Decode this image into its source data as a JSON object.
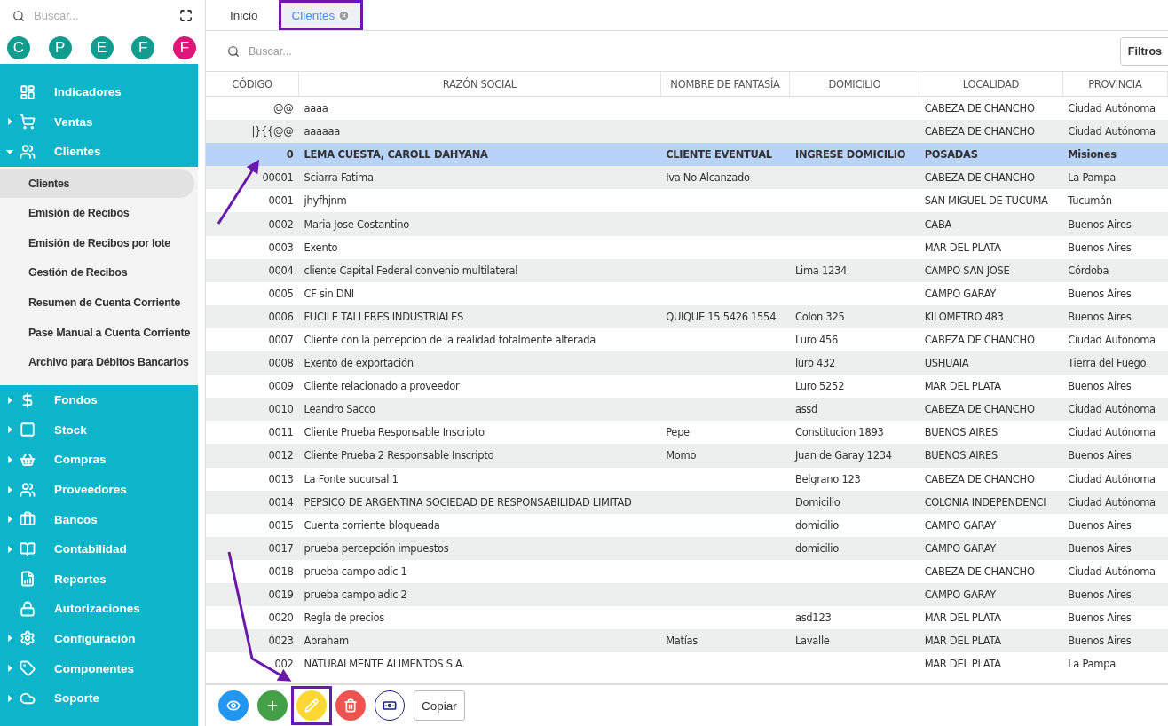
{
  "sidebar": {
    "search": {
      "placeholder": "Buscar..."
    },
    "avatars": [
      {
        "letter": "C",
        "color": "#0f9d8f"
      },
      {
        "letter": "P",
        "color": "#0f9d8f"
      },
      {
        "letter": "E",
        "color": "#0f9d8f"
      },
      {
        "letter": "F",
        "color": "#0f9d8f"
      },
      {
        "letter": "F",
        "color": "#e0157a"
      }
    ],
    "menu": [
      {
        "label": "Indicadores",
        "kind": "link"
      },
      {
        "label": "Ventas",
        "kind": "group",
        "expanded": false
      },
      {
        "label": "Clientes",
        "kind": "group",
        "expanded": true,
        "children": [
          {
            "label": "Clientes",
            "selected": true
          },
          {
            "label": "Emisión de Recibos",
            "selected": false
          },
          {
            "label": "Emisión de Recibos por lote",
            "selected": false
          },
          {
            "label": "Gestión de Recibos",
            "selected": false
          },
          {
            "label": "Resumen de Cuenta Corriente",
            "selected": false
          },
          {
            "label": "Pase Manual a Cuenta Corriente",
            "selected": false
          },
          {
            "label": "Archivo para Débitos Bancarios",
            "selected": false
          }
        ]
      },
      {
        "label": "Fondos",
        "kind": "group",
        "expanded": false
      },
      {
        "label": "Stock",
        "kind": "group",
        "expanded": false
      },
      {
        "label": "Compras",
        "kind": "group",
        "expanded": false
      },
      {
        "label": "Proveedores",
        "kind": "group",
        "expanded": false
      },
      {
        "label": "Bancos",
        "kind": "group",
        "expanded": false
      },
      {
        "label": "Contabilidad",
        "kind": "group",
        "expanded": false
      },
      {
        "label": "Reportes",
        "kind": "link"
      },
      {
        "label": "Autorizaciones",
        "kind": "link"
      },
      {
        "label": "Configuración",
        "kind": "group",
        "expanded": false
      },
      {
        "label": "Componentes",
        "kind": "group",
        "expanded": false
      },
      {
        "label": "Soporte",
        "kind": "group",
        "expanded": false
      }
    ]
  },
  "tabs": [
    {
      "label": "Inicio",
      "selected": false,
      "closable": false,
      "highlighted": false
    },
    {
      "label": "Clientes",
      "selected": true,
      "closable": true,
      "highlighted": true
    }
  ],
  "search": {
    "placeholder": "Buscar..."
  },
  "filter_button": "Filtros",
  "table": {
    "columns": [
      "CÓDIGO",
      "RAZÓN SOCIAL",
      "NOMBRE DE FANTASÍA",
      "DOMICILIO",
      "LOCALIDAD",
      "PROVINCIA"
    ],
    "rows": [
      {
        "codigo": "@@",
        "razon_social": "aaaa",
        "localidad": "CABEZA DE CHANCHO",
        "provincia": "Ciudad Autónoma",
        "selected": false
      },
      {
        "codigo": "|}{{@@",
        "razon_social": "aaaaaa",
        "localidad": "CABEZA DE CHANCHO",
        "provincia": "Ciudad Autónoma",
        "selected": false
      },
      {
        "codigo": "0",
        "razon_social": "LEMA CUESTA, CAROLL DAHYANA",
        "fantasia": "CLIENTE EVENTUAL",
        "domicilio": "INGRESE DOMICILIO",
        "localidad": "POSADAS",
        "provincia": "Misiones",
        "selected": true
      },
      {
        "codigo": "00001",
        "razon_social": "Sciarra Fatima",
        "fantasia": "Iva No Alcanzado",
        "localidad": "CABEZA DE CHANCHO",
        "provincia": "La Pampa",
        "selected": false
      },
      {
        "codigo": "0001",
        "razon_social": "jhyfhjnm",
        "localidad": "SAN MIGUEL DE TUCUMA",
        "provincia": "Tucumán",
        "selected": false
      },
      {
        "codigo": "0002",
        "razon_social": "Maria Jose Costantino",
        "localidad": "CABA",
        "provincia": "Buenos Aires",
        "selected": false
      },
      {
        "codigo": "0003",
        "razon_social": "Exento",
        "localidad": "MAR DEL PLATA",
        "provincia": "Buenos Aires",
        "selected": false
      },
      {
        "codigo": "0004",
        "razon_social": "cliente Capital Federal convenio multilateral",
        "domicilio": "Lima 1234",
        "localidad": "CAMPO SAN JOSE",
        "provincia": "Córdoba",
        "selected": false
      },
      {
        "codigo": "0005",
        "razon_social": "CF sin DNI",
        "localidad": "CAMPO GARAY",
        "provincia": "Buenos Aires",
        "selected": false
      },
      {
        "codigo": "0006",
        "razon_social": "FUCILE TALLERES INDUSTRIALES",
        "fantasia": "QUIQUE 15 5426 1554",
        "domicilio": "Colon 325",
        "localidad": "KILOMETRO 483",
        "provincia": "Buenos Aires",
        "selected": false
      },
      {
        "codigo": "0007",
        "razon_social": "Cliente con la percepcion de la realidad totalmente alterada",
        "domicilio": "Luro 456",
        "localidad": "CABEZA DE CHANCHO",
        "provincia": "Ciudad Autónoma",
        "selected": false
      },
      {
        "codigo": "0008",
        "razon_social": "Exento de exportación",
        "domicilio": "luro 432",
        "localidad": "USHUAIA",
        "provincia": "Tierra del Fuego",
        "selected": false
      },
      {
        "codigo": "0009",
        "razon_social": "Cliente relacionado a proveedor",
        "domicilio": "Luro 5252",
        "localidad": "MAR DEL PLATA",
        "provincia": "Buenos Aires",
        "selected": false
      },
      {
        "codigo": "0010",
        "razon_social": "Leandro Sacco",
        "domicilio": "assd",
        "localidad": "CABEZA DE CHANCHO",
        "provincia": "Ciudad Autónoma",
        "selected": false
      },
      {
        "codigo": "0011",
        "razon_social": "Cliente Prueba Responsable Inscripto",
        "fantasia": "Pepe",
        "domicilio": "Constitucion 1893",
        "localidad": "BUENOS AIRES",
        "provincia": "Ciudad Autónoma",
        "selected": false
      },
      {
        "codigo": "0012",
        "razon_social": "Cliente Prueba 2 Responsable Inscripto",
        "fantasia": "Momo",
        "domicilio": "Juan de Garay 1234",
        "localidad": "BUENOS AIRES",
        "provincia": "Buenos Aires",
        "selected": false
      },
      {
        "codigo": "0013",
        "razon_social": "La Fonte sucursal 1",
        "domicilio": "Belgrano 123",
        "localidad": "CABEZA DE CHANCHO",
        "provincia": "Ciudad Autónoma",
        "selected": false
      },
      {
        "codigo": "0014",
        "razon_social": "PEPSICO DE ARGENTINA SOCIEDAD DE RESPONSABILIDAD LIMITAD",
        "domicilio": "Domicilio",
        "localidad": "COLONIA INDEPENDENCI",
        "provincia": "Ciudad Autónoma",
        "selected": false
      },
      {
        "codigo": "0015",
        "razon_social": "Cuenta corriente bloqueada",
        "domicilio": "domicilio",
        "localidad": "CAMPO GARAY",
        "provincia": "Buenos Aires",
        "selected": false
      },
      {
        "codigo": "0017",
        "razon_social": "prueba percepción impuestos",
        "domicilio": "domicilio",
        "localidad": "CAMPO GARAY",
        "provincia": "Buenos Aires",
        "selected": false
      },
      {
        "codigo": "0018",
        "razon_social": "prueba campo adic 1",
        "localidad": "CABEZA DE CHANCHO",
        "provincia": "Ciudad Autónoma",
        "selected": false
      },
      {
        "codigo": "0019",
        "razon_social": "prueba campo adic 2",
        "localidad": "CAMPO GARAY",
        "provincia": "Buenos Aires",
        "selected": false
      },
      {
        "codigo": "0020",
        "razon_social": "Regla de precios",
        "domicilio": "asd123",
        "localidad": "MAR DEL PLATA",
        "provincia": "Buenos Aires",
        "selected": false
      },
      {
        "codigo": "0023",
        "razon_social": "Abraham",
        "fantasia": "Matías",
        "domicilio": "Lavalle",
        "localidad": "MAR DEL PLATA",
        "provincia": "Buenos Aires",
        "selected": false
      },
      {
        "codigo": "002",
        "razon_social": "NATURALMENTE ALIMENTOS S.A.",
        "localidad": "MAR DEL PLATA",
        "provincia": "La Pampa",
        "selected": false
      }
    ]
  },
  "toolbar": [
    {
      "kind": "view",
      "color": "#2196f3",
      "highlighted": false
    },
    {
      "kind": "add",
      "color": "#43a047",
      "highlighted": false
    },
    {
      "kind": "edit",
      "color": "#fdd835",
      "highlighted": true
    },
    {
      "kind": "delete",
      "color": "#ef5350",
      "highlighted": false
    },
    {
      "kind": "payment",
      "color": "#1a237e",
      "highlighted": false
    },
    {
      "kind": "text",
      "label": "Copiar",
      "highlighted": false
    }
  ]
}
